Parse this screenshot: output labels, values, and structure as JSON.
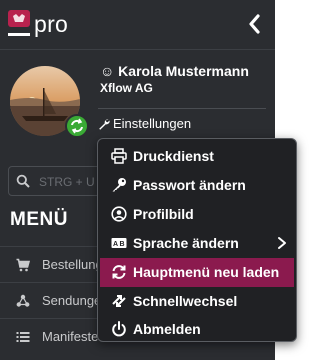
{
  "header": {
    "brand": "pro"
  },
  "user": {
    "name": "☺ Karola Mustermann",
    "company": "Xflow AG",
    "settings_label": "Einstellungen"
  },
  "search": {
    "placeholder": "STRG + U"
  },
  "menu": {
    "heading": "MENÜ",
    "items": [
      {
        "label": "Bestellungen",
        "icon": "cart-icon"
      },
      {
        "label": "Sendungen",
        "icon": "share-icon"
      },
      {
        "label": "Manifeste",
        "icon": "list-icon"
      }
    ]
  },
  "dropdown": {
    "items": [
      {
        "label": "Druckdienst",
        "icon": "printer-icon"
      },
      {
        "label": "Passwort ändern",
        "icon": "key-icon"
      },
      {
        "label": "Profilbild",
        "icon": "user-circle-icon"
      },
      {
        "label": "Sprache ändern",
        "icon": "language-icon",
        "has_submenu": true
      },
      {
        "label": "Hauptmenü neu laden",
        "icon": "refresh-icon",
        "active": true
      },
      {
        "label": "Schnellwechsel",
        "icon": "swap-icon"
      },
      {
        "label": "Abmelden",
        "icon": "power-icon"
      }
    ]
  },
  "colors": {
    "sidebar_bg": "#2b2d31",
    "dropdown_bg": "#202124",
    "active_item": "#8b1a4e",
    "status_green": "#3aaa35",
    "logo_red": "#b8224e"
  }
}
